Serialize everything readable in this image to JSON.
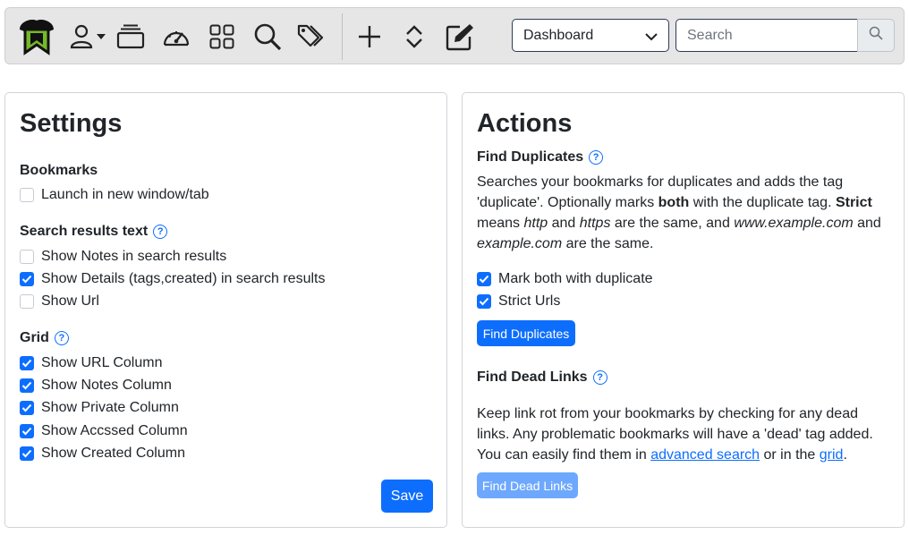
{
  "toolbar": {
    "icons": [
      "logo-icon",
      "user-icon",
      "caret-down-icon",
      "collections-icon",
      "dashboard-gauge-icon",
      "grid-icon",
      "search-icon",
      "tags-icon",
      "add-icon",
      "expand-collapse-icon",
      "edit-icon"
    ],
    "view_select": "Dashboard",
    "search_placeholder": "Search"
  },
  "settings": {
    "title": "Settings",
    "bookmarks": {
      "heading": "Bookmarks",
      "items": [
        {
          "label": "Launch in new window/tab",
          "checked": false
        }
      ]
    },
    "search_results": {
      "heading": "Search results text",
      "items": [
        {
          "label": "Show Notes in search results",
          "checked": false
        },
        {
          "label": "Show Details (tags,created) in search results",
          "checked": true
        },
        {
          "label": "Show Url",
          "checked": false
        }
      ]
    },
    "grid": {
      "heading": "Grid",
      "items": [
        {
          "label": "Show URL Column",
          "checked": true
        },
        {
          "label": "Show Notes Column",
          "checked": true
        },
        {
          "label": "Show Private Column",
          "checked": true
        },
        {
          "label": "Show Accssed Column",
          "checked": true
        },
        {
          "label": "Show Created Column",
          "checked": true
        }
      ]
    },
    "save_label": "Save"
  },
  "actions": {
    "title": "Actions",
    "find_duplicates": {
      "heading": "Find Duplicates",
      "desc_1": "Searches your bookmarks for duplicates and adds the tag 'duplicate'. Optionally marks ",
      "desc_bold_1": "both",
      "desc_2": " with the duplicate tag. ",
      "desc_bold_2": "Strict",
      "desc_3": " means ",
      "desc_em_1": "http",
      "desc_4": " and ",
      "desc_em_2": "https",
      "desc_5": " are the same, and ",
      "desc_em_3": "www.example.com",
      "desc_6": " and ",
      "desc_em_4": "example.com",
      "desc_7": " are the same.",
      "items": [
        {
          "label": "Mark both with duplicate",
          "checked": true
        },
        {
          "label": "Strict Urls",
          "checked": true
        }
      ],
      "button": "Find Duplicates"
    },
    "find_dead_links": {
      "heading": "Find Dead Links",
      "desc_1": "Keep link rot from your bookmarks by checking for any dead links. Any problematic bookmarks will have a 'dead' tag added. You can easily find them in ",
      "link_1": "advanced search",
      "desc_2": " or in the ",
      "link_2": "grid",
      "desc_3": ".",
      "button": "Find Dead Links"
    }
  },
  "colors": {
    "accent": "#0d6efd",
    "accent_disabled": "#6ea8fe",
    "toolbar_bg": "#e6e6e6"
  }
}
